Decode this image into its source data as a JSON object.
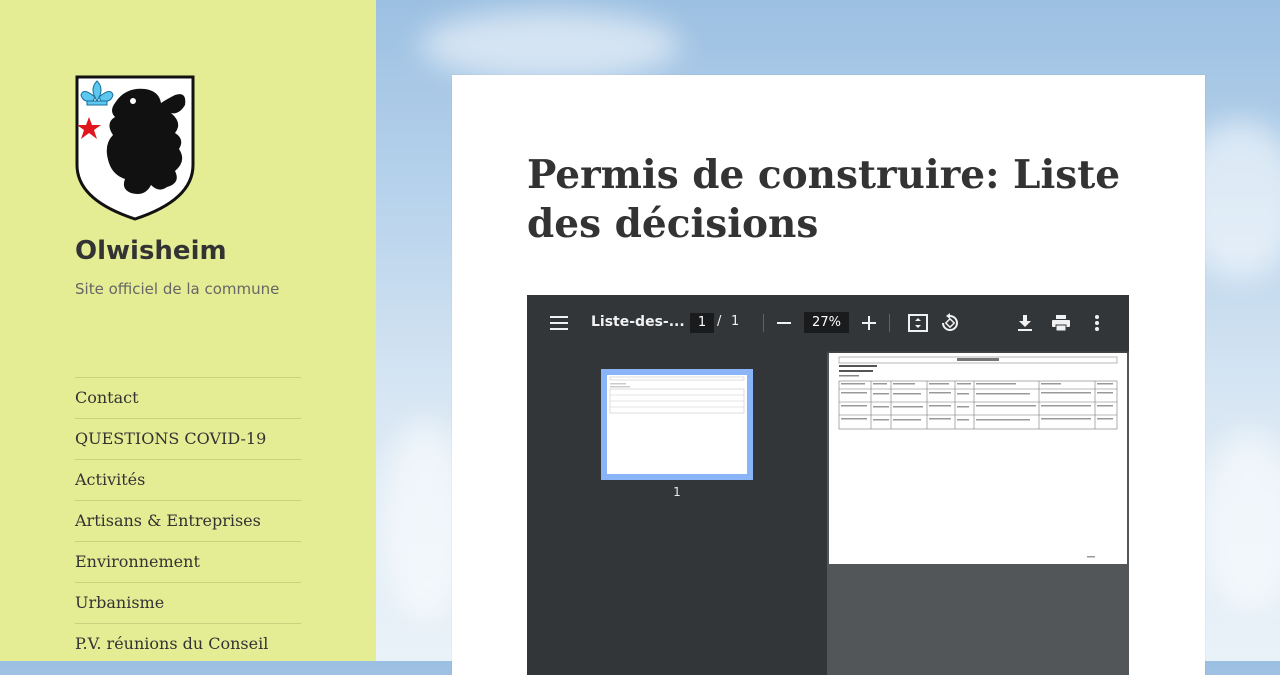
{
  "site": {
    "title": "Olwisheim",
    "description": "Site officiel de la commune"
  },
  "nav": {
    "items": [
      {
        "label": "Contact"
      },
      {
        "label": "QUESTIONS COVID-19"
      },
      {
        "label": "Activités"
      },
      {
        "label": "Artisans & Entreprises"
      },
      {
        "label": "Environnement"
      },
      {
        "label": "Urbanisme"
      },
      {
        "label": "P.V. réunions du Conseil"
      }
    ]
  },
  "page": {
    "title": "Permis de construire: Liste des décisions"
  },
  "pdf_viewer": {
    "doc_title": "Liste-des-...",
    "current_page": "1",
    "page_separator": "/",
    "total_pages": "1",
    "zoom": "27%",
    "thumbnail_label": "1",
    "icons": [
      "menu-icon",
      "zoom-out-icon",
      "zoom-in-icon",
      "fit-page-icon",
      "rotate-icon",
      "download-icon",
      "print-icon",
      "more-icon"
    ]
  },
  "colors": {
    "sidebar_bg": "#e4ed94",
    "toolbar_bg": "#323639",
    "thumb_highlight": "#8ab4f8"
  }
}
